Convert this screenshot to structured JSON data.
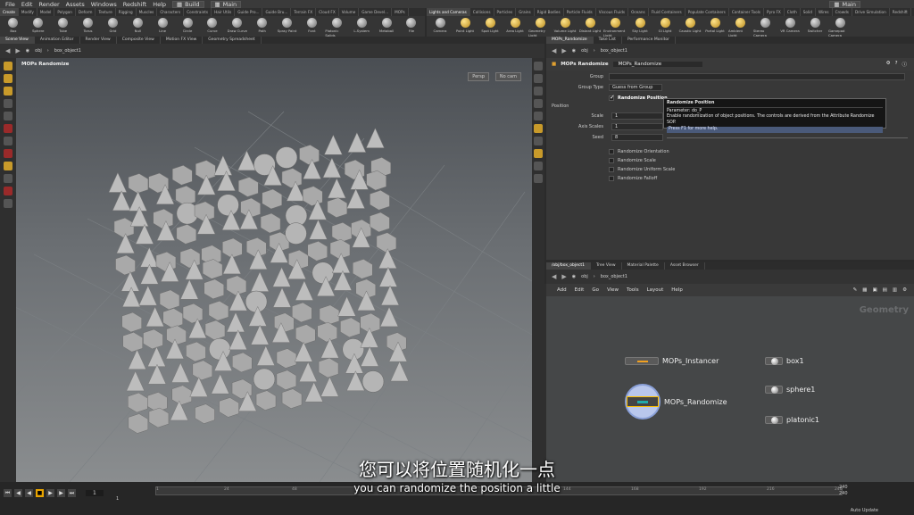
{
  "menubar": {
    "items": [
      "File",
      "Edit",
      "Render",
      "Assets",
      "Windows",
      "Redshift",
      "Help"
    ],
    "desktop": "Build",
    "context": "Main",
    "right_context": "Main"
  },
  "shelf_left": {
    "tabs": [
      "Create",
      "Modify",
      "Model",
      "Polygon",
      "Deform",
      "Texture",
      "Rigging",
      "Muscles",
      "Characters",
      "Constraints",
      "Hair Utils",
      "Guide Pro...",
      "Guide Bru...",
      "Terrain FX",
      "Cloud FX",
      "Volume",
      "Game Devel...",
      "MOPs"
    ],
    "tools": [
      "Box",
      "Sphere",
      "Tube",
      "Torus",
      "Grid",
      "Null",
      "Line",
      "Circle",
      "Curve",
      "Draw Curve",
      "Path",
      "Spray Paint",
      "Font",
      "Platonic Solids",
      "L-System",
      "Metaball",
      "File"
    ]
  },
  "shelf_right": {
    "tabs": [
      "Lights and Cameras",
      "Collisions",
      "Particles",
      "Grains",
      "Rigid Bodies",
      "Particle Fluids",
      "Viscous Fluids",
      "Oceans",
      "Fluid Containers",
      "Populate Containers",
      "Container Tools",
      "Pyro FX",
      "Cloth",
      "Solid",
      "Wires",
      "Crowds",
      "Drive Simulation",
      "Redshift"
    ],
    "tools": [
      "Camera",
      "Point Light",
      "Spot Light",
      "Area Light",
      "Geometry Light",
      "Volume Light",
      "Distant Light",
      "Environment Light",
      "Sky Light",
      "GI Light",
      "Caustic Light",
      "Portal Light",
      "Ambient Light",
      "Stereo Camera",
      "VR Camera",
      "Switcher",
      "Gamepad Camera"
    ]
  },
  "viewport": {
    "tabs": [
      "Scene View",
      "Animation Editor",
      "Render View",
      "Composite View",
      "Motion FX View",
      "Geometry Spreadsheet"
    ],
    "path": [
      "obj",
      "box_object1"
    ],
    "title": "MOPs Randomize",
    "persp": "Persp",
    "cam": "No cam"
  },
  "params": {
    "tabs": [
      "MOPs_Randomize",
      "Take List",
      "Performance Monitor"
    ],
    "path": [
      "obj",
      "box_object1"
    ],
    "node_type": "MOPs Randomize",
    "node_name": "MOPs_Randomize",
    "group_label": "Group",
    "group_type_label": "Group Type",
    "group_type_value": "Guess from Group",
    "randomize_position": "Randomize Position",
    "section": "Position",
    "scale_label": "Scale",
    "scale_value": "1",
    "axis_scales_label": "Axis Scales",
    "axis_scales_value": "1",
    "seed_label": "Seed",
    "seed_value": "8",
    "checks": [
      "Randomize Orientation",
      "Randomize Scale",
      "Randomize Uniform Scale",
      "Randomize Falloff"
    ]
  },
  "tooltip": {
    "title": "Randomize Position",
    "parameter": "Parameter: do_P",
    "desc": "Enable randomization of object positions. The controls are derived from the Attribute Randomize SOP.",
    "help": "Press F1 for more help."
  },
  "network": {
    "tabs": [
      "/obj/box_object1",
      "Tree View",
      "Material Palette",
      "Asset Browser"
    ],
    "path": [
      "obj",
      "box_object1"
    ],
    "menu": [
      "Add",
      "Edit",
      "Go",
      "View",
      "Tools",
      "Layout",
      "Help"
    ],
    "context_label": "Geometry",
    "nodes": {
      "instancer": "MOPs_Instancer",
      "randomize": "MOPs_Randomize",
      "box": "box1",
      "sphere": "sphere1",
      "platonic": "platonic1"
    }
  },
  "timeline": {
    "frame": "1",
    "start": "1",
    "end": "1",
    "ticks": [
      "1",
      "24",
      "48",
      "72",
      "96",
      "120",
      "144",
      "168",
      "192",
      "216",
      "240"
    ],
    "range_end_a": "240",
    "range_end_b": "240",
    "auto_update": "Auto Update"
  },
  "subtitles": {
    "chinese": "您可以将位置随机化一点",
    "english": "you can randomize the position a little"
  }
}
